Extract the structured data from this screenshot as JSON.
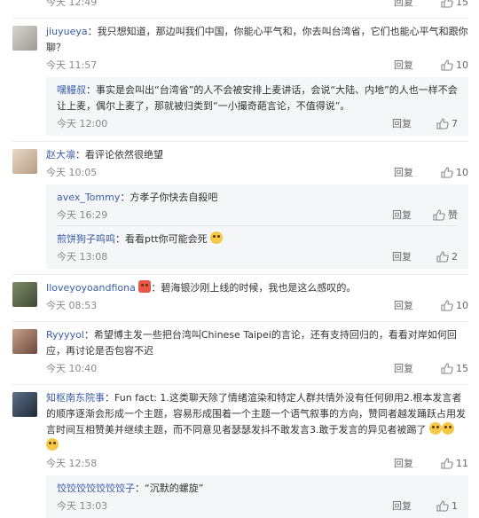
{
  "top": {
    "time": "今天 12:49",
    "reply": "回复",
    "likes": "15"
  },
  "comments": [
    {
      "user": "jiuyueya",
      "text": "我只想知道，那边叫我们中国，你能心平气和，你去叫台湾省，它们也能心平气和跟你聊？",
      "time": "今天 11:57",
      "reply": "回复",
      "likes": "10",
      "replies": [
        {
          "user": "嘿鳗叔",
          "text": "事实是会叫出“台湾省”的人不会被安排上麦讲话，会说“大陆、内地”的人也一样不会让上麦，偶尔上麦了，那就被归类到“一小撮奇葩言论，不值得说”。",
          "time": "今天 12:00",
          "reply": "回复",
          "likes": "7"
        }
      ]
    },
    {
      "user": "赵大凛",
      "text": "看评论依然很绝望",
      "time": "今天 10:05",
      "reply": "回复",
      "likes": "10",
      "replies": [
        {
          "user": "avex_Tommy",
          "text": "方孝子你快去自殺吧",
          "time": "今天 16:29",
          "reply": "回复",
          "likes": "赞"
        },
        {
          "user": "煎饼狗子呜呜",
          "text": "看看ptt你可能会死",
          "time": "今天 13:08",
          "reply": "回复",
          "likes": "2"
        }
      ]
    },
    {
      "user": "Iloveyoyoandfiona",
      "text": "碧海银沙刚上线的时候，我也是这么感叹的。",
      "time": "今天 08:53",
      "reply": "回复",
      "likes": "10"
    },
    {
      "user": "Ryyyyol",
      "text": "希望博主发一些把台湾叫Chinese Taipei的言论，还有支持回归的，看看对岸如何回应，再讨论是否包容不迟",
      "time": "今天 10:40",
      "reply": "回复",
      "likes": "15"
    },
    {
      "user": "知枢南东院事",
      "text": "Fun fact: 1.这类聊天除了情绪渲染和特定人群共情外没有任何卵用2.根本发言者的顺序逐渐会形成一个主题，容易形成围着一个主题一个语气叙事的方向，赞同者越发踊跃占用发言时间互相赞美并继续主题，而不同意见者瑟瑟发抖不敢发言3.敢于发言的异见者被踢了",
      "time": "今天 12:58",
      "reply": "回复",
      "likes": "11",
      "replies": [
        {
          "user": "饺饺饺饺饺饺饺子",
          "text": "“沉默的螺旋”",
          "time": "今天 13:03",
          "reply": "回复",
          "likes": "1"
        }
      ]
    }
  ],
  "colors": {
    "username": "#3a5da8",
    "subbg": "#f5f6f8"
  }
}
